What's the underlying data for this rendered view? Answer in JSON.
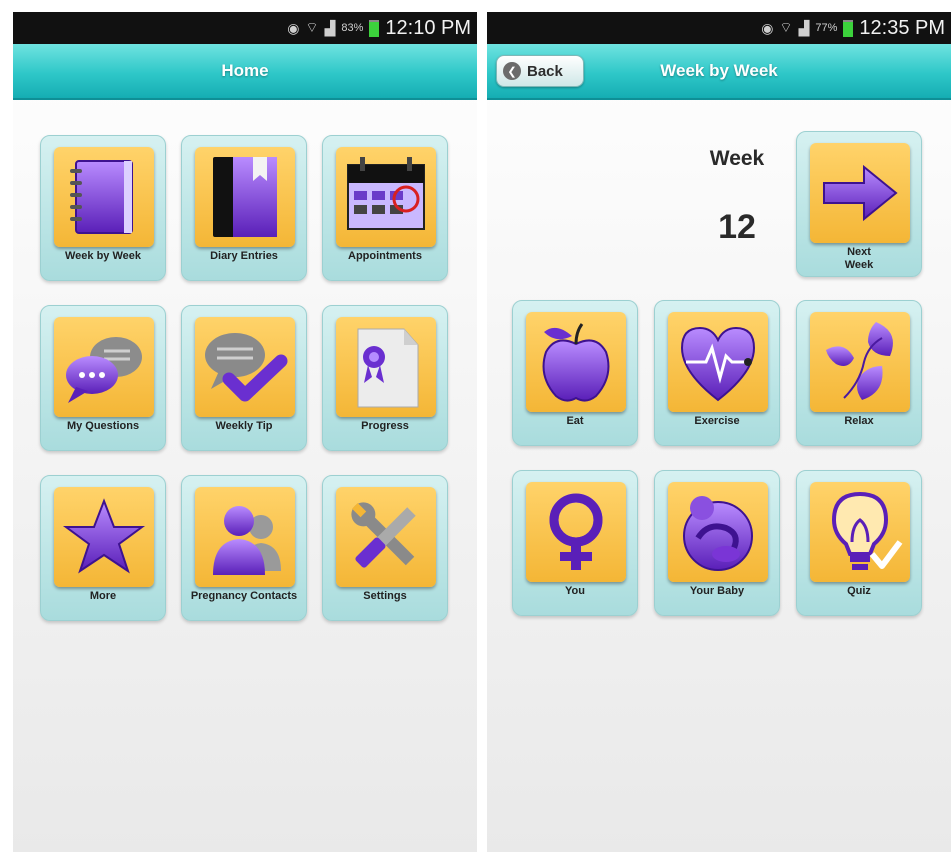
{
  "home_screen": {
    "status": {
      "battery": "83%",
      "time": "12:10 PM"
    },
    "title": "Home",
    "tiles": [
      {
        "label": "Week by Week",
        "icon": "notebook-icon"
      },
      {
        "label": "Diary Entries",
        "icon": "diary-icon"
      },
      {
        "label": "Appointments",
        "icon": "calendar-icon"
      },
      {
        "label": "My Questions",
        "icon": "chat-bubbles-icon"
      },
      {
        "label": "Weekly Tip",
        "icon": "chat-check-icon"
      },
      {
        "label": "Progress",
        "icon": "certificate-icon"
      },
      {
        "label": "More",
        "icon": "star-icon"
      },
      {
        "label": "Pregnancy Contacts",
        "icon": "contacts-icon"
      },
      {
        "label": "Settings",
        "icon": "tools-icon"
      }
    ]
  },
  "week_screen": {
    "status": {
      "battery": "77%",
      "time": "12:35 PM"
    },
    "back_label": "Back",
    "title": "Week by Week",
    "week_word": "Week",
    "week_number": "12",
    "next_week": {
      "label": "Next Week",
      "icon": "arrow-right-icon"
    },
    "tiles": [
      {
        "label": "Eat",
        "icon": "apple-icon"
      },
      {
        "label": "Exercise",
        "icon": "heart-pulse-icon"
      },
      {
        "label": "Relax",
        "icon": "leaves-icon"
      },
      {
        "label": "You",
        "icon": "female-symbol-icon"
      },
      {
        "label": "Your Baby",
        "icon": "baby-icon"
      },
      {
        "label": "Quiz",
        "icon": "lightbulb-icon"
      }
    ]
  },
  "colors": {
    "header_teal": "#2ec7c8",
    "icon_gold": "#f4b636",
    "icon_purple": "#7a35d6",
    "tile_bg": "#bfe6e6"
  }
}
